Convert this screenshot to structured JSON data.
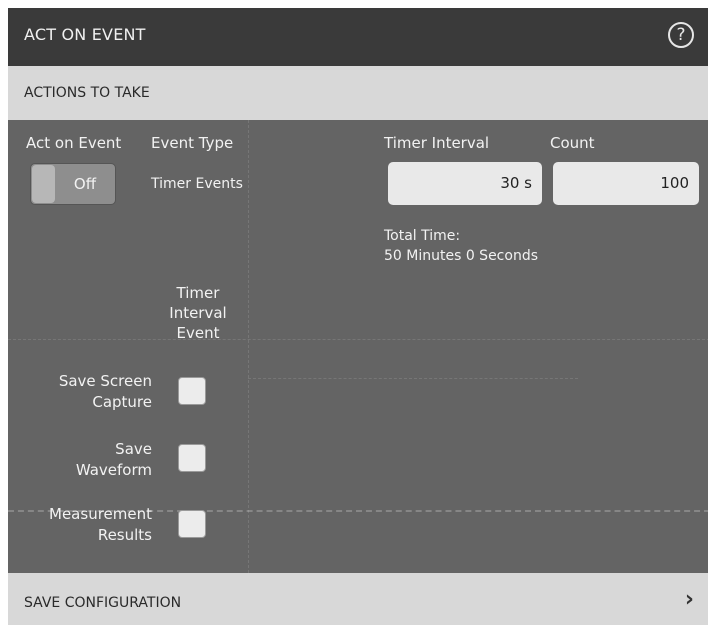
{
  "title": "ACT ON EVENT",
  "help_icon": "?",
  "section": "ACTIONS TO TAKE",
  "act_on_event": {
    "label": "Act on Event",
    "state": "Off"
  },
  "event_type": {
    "label": "Event Type",
    "value": "Timer Events"
  },
  "timer_interval": {
    "label": "Timer Interval",
    "value": "30 s"
  },
  "count": {
    "label": "Count",
    "value": "100"
  },
  "total_time": {
    "label": "Total Time:",
    "value": "50 Minutes 0 Seconds"
  },
  "column_header": [
    "Timer",
    "Interval",
    "Event"
  ],
  "actions": [
    {
      "line1": "Save Screen",
      "line2": "Capture",
      "checked": false
    },
    {
      "line1": "Save",
      "line2": "Waveform",
      "checked": false
    },
    {
      "line1": "Measurement",
      "line2": "Results",
      "checked": false
    }
  ],
  "footer": {
    "label": "SAVE CONFIGURATION",
    "chevron_icon": "›"
  }
}
